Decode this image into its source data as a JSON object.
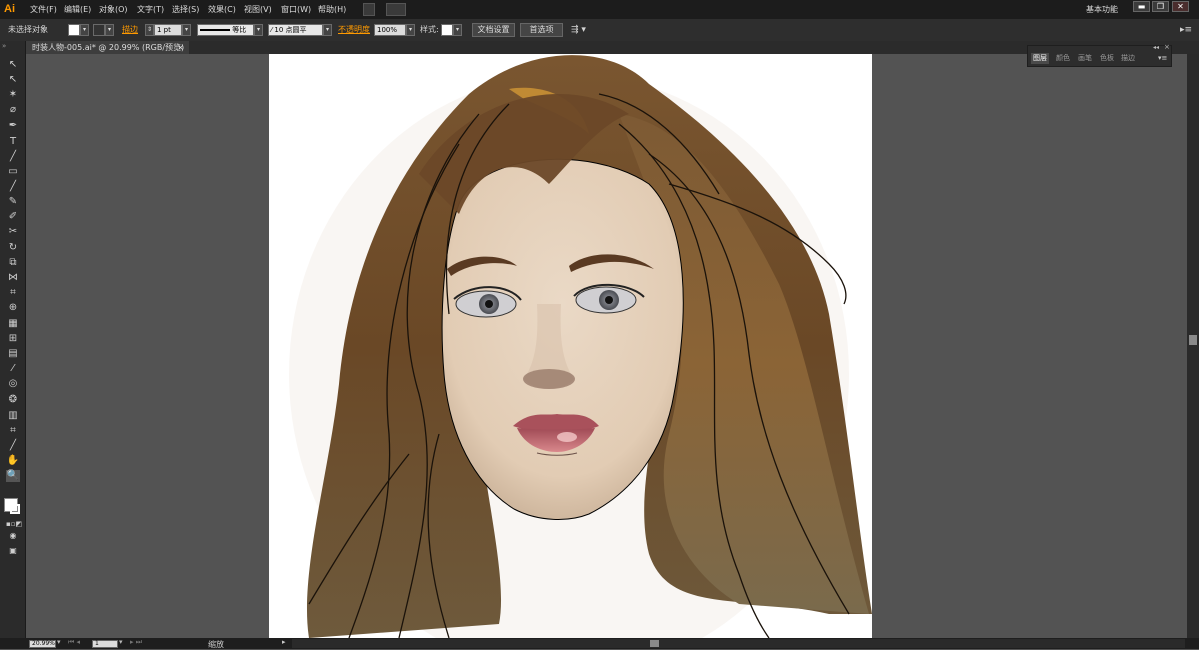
{
  "app": {
    "logo": "Ai",
    "workspace": "基本功能"
  },
  "menu": [
    {
      "id": "file",
      "label": "文件(F)"
    },
    {
      "id": "edit",
      "label": "编辑(E)"
    },
    {
      "id": "object",
      "label": "对象(O)"
    },
    {
      "id": "type",
      "label": "文字(T)"
    },
    {
      "id": "select",
      "label": "选择(S)"
    },
    {
      "id": "effect",
      "label": "效果(C)"
    },
    {
      "id": "view",
      "label": "视图(V)"
    },
    {
      "id": "window",
      "label": "窗口(W)"
    },
    {
      "id": "help",
      "label": "帮助(H)"
    }
  ],
  "window_controls": {
    "minimize": "▬",
    "restore": "❐",
    "close": "✕"
  },
  "control_bar": {
    "selection": "未选择对象",
    "stroke_label": "描边",
    "stroke_weight": "1 pt",
    "profile": "等比",
    "brush": "10 点圆平",
    "opacity_label": "不透明度",
    "opacity_value": "100%",
    "style_label": "样式:",
    "doc_setup": "文档设置",
    "preferences": "首选项"
  },
  "document_tab": {
    "title": "时装人物-005.ai* @ 20.99% (RGB/预览)",
    "close": "×"
  },
  "panel": {
    "tabs": [
      "图层",
      "颜色",
      "画笔",
      "色板",
      "描边"
    ],
    "collapse": "◂◂",
    "close": "×"
  },
  "status": {
    "zoom": "20.99%",
    "artboard": "1",
    "tool_label": "缩放"
  },
  "colors": {
    "accent": "#ff9a00",
    "bg": "#535353",
    "hair": "#6b4a26",
    "skin": "#e7d6c4",
    "lips": "#c06a70"
  }
}
